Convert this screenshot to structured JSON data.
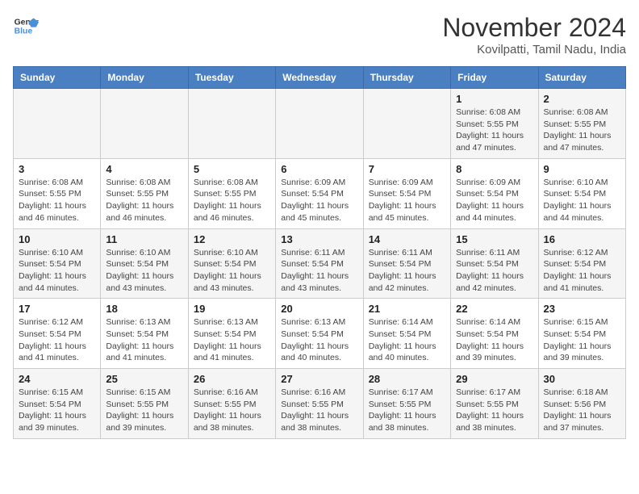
{
  "logo": {
    "line1": "General",
    "line2": "Blue"
  },
  "title": "November 2024",
  "subtitle": "Kovilpatti, Tamil Nadu, India",
  "weekdays": [
    "Sunday",
    "Monday",
    "Tuesday",
    "Wednesday",
    "Thursday",
    "Friday",
    "Saturday"
  ],
  "weeks": [
    [
      {
        "day": "",
        "info": ""
      },
      {
        "day": "",
        "info": ""
      },
      {
        "day": "",
        "info": ""
      },
      {
        "day": "",
        "info": ""
      },
      {
        "day": "",
        "info": ""
      },
      {
        "day": "1",
        "info": "Sunrise: 6:08 AM\nSunset: 5:55 PM\nDaylight: 11 hours\nand 47 minutes."
      },
      {
        "day": "2",
        "info": "Sunrise: 6:08 AM\nSunset: 5:55 PM\nDaylight: 11 hours\nand 47 minutes."
      }
    ],
    [
      {
        "day": "3",
        "info": "Sunrise: 6:08 AM\nSunset: 5:55 PM\nDaylight: 11 hours\nand 46 minutes."
      },
      {
        "day": "4",
        "info": "Sunrise: 6:08 AM\nSunset: 5:55 PM\nDaylight: 11 hours\nand 46 minutes."
      },
      {
        "day": "5",
        "info": "Sunrise: 6:08 AM\nSunset: 5:55 PM\nDaylight: 11 hours\nand 46 minutes."
      },
      {
        "day": "6",
        "info": "Sunrise: 6:09 AM\nSunset: 5:54 PM\nDaylight: 11 hours\nand 45 minutes."
      },
      {
        "day": "7",
        "info": "Sunrise: 6:09 AM\nSunset: 5:54 PM\nDaylight: 11 hours\nand 45 minutes."
      },
      {
        "day": "8",
        "info": "Sunrise: 6:09 AM\nSunset: 5:54 PM\nDaylight: 11 hours\nand 44 minutes."
      },
      {
        "day": "9",
        "info": "Sunrise: 6:10 AM\nSunset: 5:54 PM\nDaylight: 11 hours\nand 44 minutes."
      }
    ],
    [
      {
        "day": "10",
        "info": "Sunrise: 6:10 AM\nSunset: 5:54 PM\nDaylight: 11 hours\nand 44 minutes."
      },
      {
        "day": "11",
        "info": "Sunrise: 6:10 AM\nSunset: 5:54 PM\nDaylight: 11 hours\nand 43 minutes."
      },
      {
        "day": "12",
        "info": "Sunrise: 6:10 AM\nSunset: 5:54 PM\nDaylight: 11 hours\nand 43 minutes."
      },
      {
        "day": "13",
        "info": "Sunrise: 6:11 AM\nSunset: 5:54 PM\nDaylight: 11 hours\nand 43 minutes."
      },
      {
        "day": "14",
        "info": "Sunrise: 6:11 AM\nSunset: 5:54 PM\nDaylight: 11 hours\nand 42 minutes."
      },
      {
        "day": "15",
        "info": "Sunrise: 6:11 AM\nSunset: 5:54 PM\nDaylight: 11 hours\nand 42 minutes."
      },
      {
        "day": "16",
        "info": "Sunrise: 6:12 AM\nSunset: 5:54 PM\nDaylight: 11 hours\nand 41 minutes."
      }
    ],
    [
      {
        "day": "17",
        "info": "Sunrise: 6:12 AM\nSunset: 5:54 PM\nDaylight: 11 hours\nand 41 minutes."
      },
      {
        "day": "18",
        "info": "Sunrise: 6:13 AM\nSunset: 5:54 PM\nDaylight: 11 hours\nand 41 minutes."
      },
      {
        "day": "19",
        "info": "Sunrise: 6:13 AM\nSunset: 5:54 PM\nDaylight: 11 hours\nand 41 minutes."
      },
      {
        "day": "20",
        "info": "Sunrise: 6:13 AM\nSunset: 5:54 PM\nDaylight: 11 hours\nand 40 minutes."
      },
      {
        "day": "21",
        "info": "Sunrise: 6:14 AM\nSunset: 5:54 PM\nDaylight: 11 hours\nand 40 minutes."
      },
      {
        "day": "22",
        "info": "Sunrise: 6:14 AM\nSunset: 5:54 PM\nDaylight: 11 hours\nand 39 minutes."
      },
      {
        "day": "23",
        "info": "Sunrise: 6:15 AM\nSunset: 5:54 PM\nDaylight: 11 hours\nand 39 minutes."
      }
    ],
    [
      {
        "day": "24",
        "info": "Sunrise: 6:15 AM\nSunset: 5:54 PM\nDaylight: 11 hours\nand 39 minutes."
      },
      {
        "day": "25",
        "info": "Sunrise: 6:15 AM\nSunset: 5:55 PM\nDaylight: 11 hours\nand 39 minutes."
      },
      {
        "day": "26",
        "info": "Sunrise: 6:16 AM\nSunset: 5:55 PM\nDaylight: 11 hours\nand 38 minutes."
      },
      {
        "day": "27",
        "info": "Sunrise: 6:16 AM\nSunset: 5:55 PM\nDaylight: 11 hours\nand 38 minutes."
      },
      {
        "day": "28",
        "info": "Sunrise: 6:17 AM\nSunset: 5:55 PM\nDaylight: 11 hours\nand 38 minutes."
      },
      {
        "day": "29",
        "info": "Sunrise: 6:17 AM\nSunset: 5:55 PM\nDaylight: 11 hours\nand 38 minutes."
      },
      {
        "day": "30",
        "info": "Sunrise: 6:18 AM\nSunset: 5:56 PM\nDaylight: 11 hours\nand 37 minutes."
      }
    ]
  ]
}
